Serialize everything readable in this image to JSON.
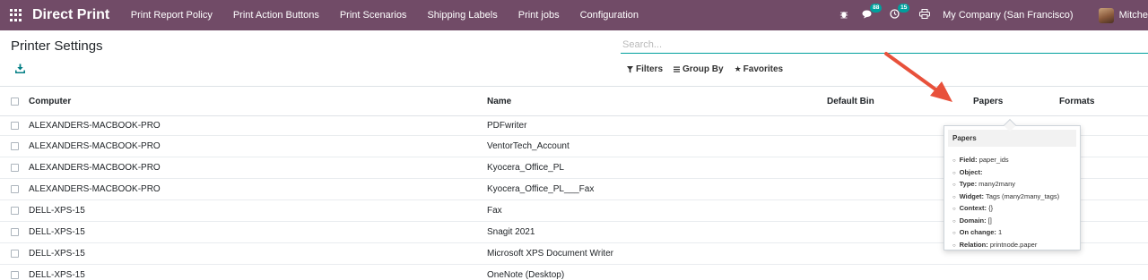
{
  "navbar": {
    "brand": "Direct Print",
    "menu": [
      "Print Report Policy",
      "Print Action Buttons",
      "Print Scenarios",
      "Shipping Labels",
      "Print jobs",
      "Configuration"
    ],
    "messages_badge": "88",
    "activity_badge": "15",
    "company": "My Company (San Francisco)",
    "user": "Mitche"
  },
  "control_panel": {
    "title": "Printer Settings",
    "search_placeholder": "Search...",
    "filters_label": "Filters",
    "group_by_label": "Group By",
    "favorites_label": "Favorites"
  },
  "table": {
    "columns": [
      "Computer",
      "Name",
      "Default Bin",
      "Papers",
      "Formats"
    ],
    "rows": [
      {
        "computer": "ALEXANDERS-MACBOOK-PRO",
        "name": "PDFwriter"
      },
      {
        "computer": "ALEXANDERS-MACBOOK-PRO",
        "name": "VentorTech_Account"
      },
      {
        "computer": "ALEXANDERS-MACBOOK-PRO",
        "name": "Kyocera_Office_PL"
      },
      {
        "computer": "ALEXANDERS-MACBOOK-PRO",
        "name": "Kyocera_Office_PL___Fax"
      },
      {
        "computer": "DELL-XPS-15",
        "name": "Fax"
      },
      {
        "computer": "DELL-XPS-15",
        "name": "Snagit 2021"
      },
      {
        "computer": "DELL-XPS-15",
        "name": "Microsoft XPS Document Writer"
      },
      {
        "computer": "DELL-XPS-15",
        "name": "OneNote (Desktop)"
      }
    ]
  },
  "tooltip": {
    "title": "Papers",
    "items": [
      {
        "label": "Field:",
        "value": "paper_ids"
      },
      {
        "label": "Object:",
        "value": ""
      },
      {
        "label": "Type:",
        "value": "many2many"
      },
      {
        "label": "Widget:",
        "value": "Tags (many2many_tags)"
      },
      {
        "label": "Context:",
        "value": "{}"
      },
      {
        "label": "Domain:",
        "value": "[]"
      },
      {
        "label": "On change:",
        "value": "1"
      },
      {
        "label": "Relation:",
        "value": "printnode.paper"
      }
    ]
  },
  "colors": {
    "navbar": "#714b67",
    "accent": "#00a09d",
    "annotation_arrow": "#e8513b"
  }
}
